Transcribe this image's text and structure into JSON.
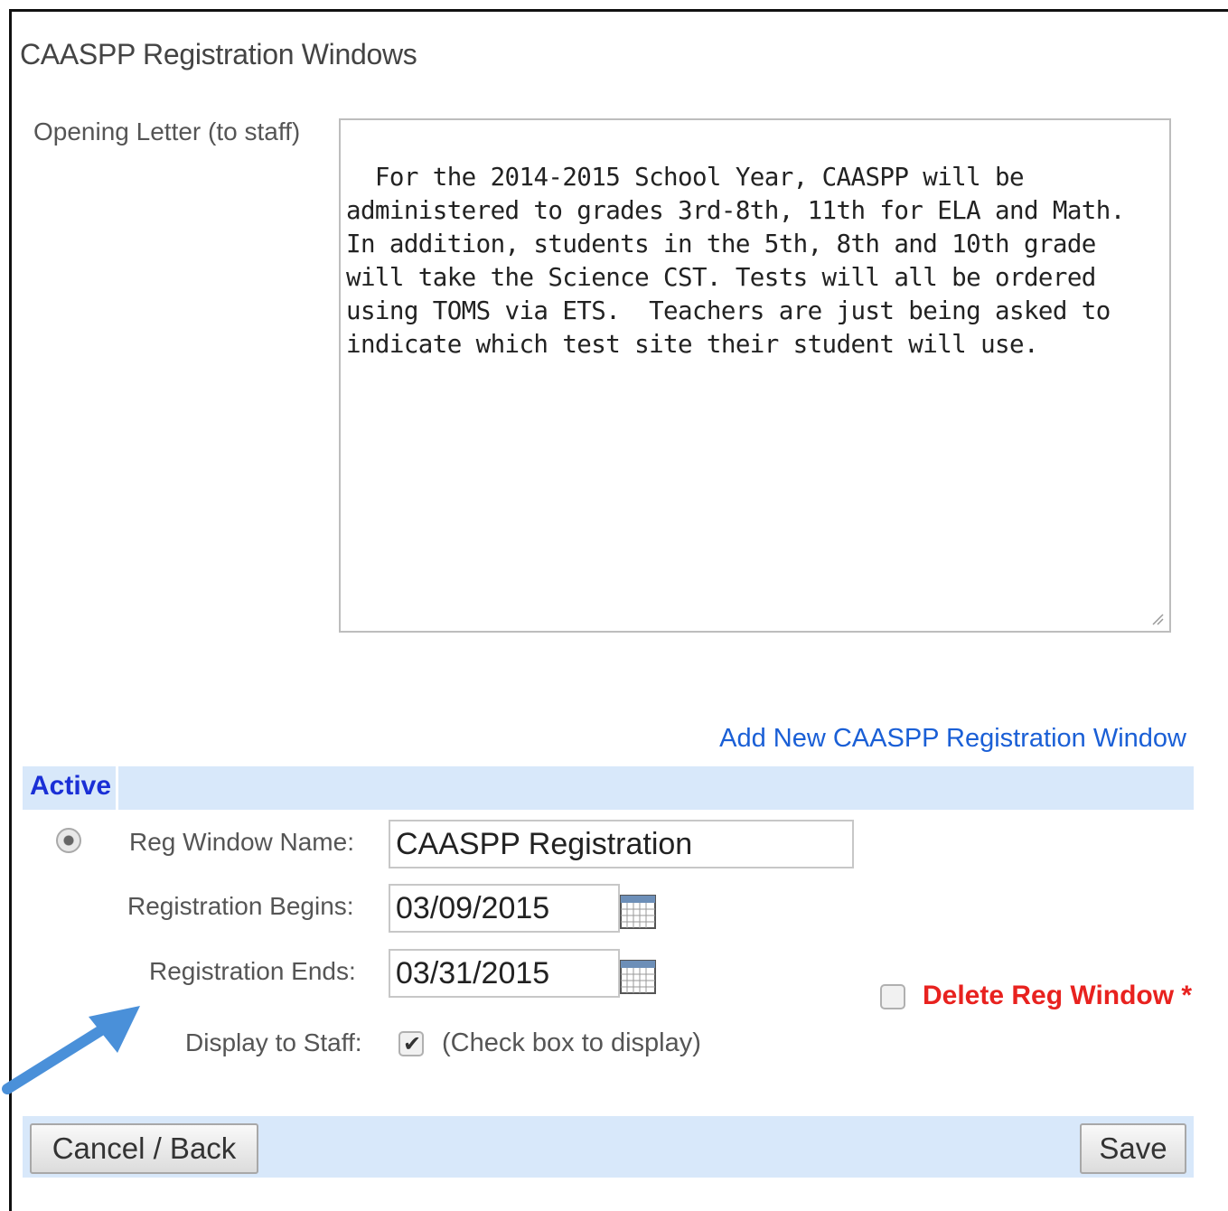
{
  "page": {
    "title": "CAASPP Registration Windows"
  },
  "opening_letter": {
    "label": "Opening Letter (to staff)",
    "value": "For the 2014-2015 School Year, CAASPP will be administered to grades 3rd-8th, 11th for ELA and Math. In addition, students in the 5th, 8th and 10th grade will take the Science CST. Tests will all be ordered using TOMS via ETS.  Teachers are just being asked to indicate which test site their student will use."
  },
  "add_link": {
    "label": "Add New CAASPP Registration Window"
  },
  "section": {
    "label": "Active"
  },
  "reg_window": {
    "selected": true,
    "name_label": "Reg Window Name:",
    "name_value": "CAASPP Registration",
    "begins_label": "Registration Begins:",
    "begins_value": "03/09/2015",
    "ends_label": "Registration Ends:",
    "ends_value": "03/31/2015",
    "display_label": "Display to Staff:",
    "display_checked": true,
    "display_hint": "(Check box to display)",
    "delete_label": "Delete Reg Window *",
    "delete_checked": false
  },
  "buttons": {
    "cancel": "Cancel / Back",
    "save": "Save"
  },
  "colors": {
    "section_bar": "#d8e8fa",
    "link": "#1a5fd6",
    "delete": "#e8221f",
    "arrow": "#4a90d9"
  },
  "icons": [
    "calendar-icon",
    "resize-grip-icon",
    "checkmark-icon",
    "annotation-arrow-icon"
  ]
}
